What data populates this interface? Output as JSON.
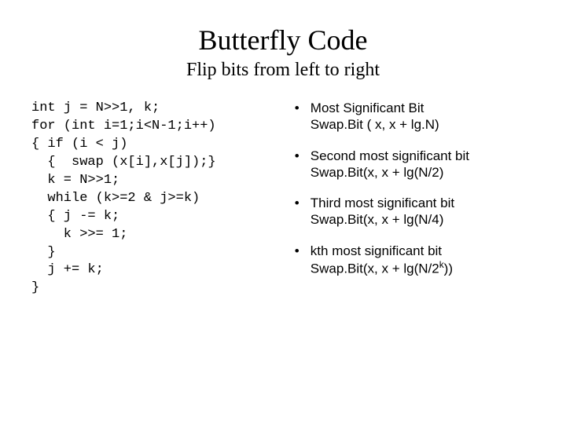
{
  "title": "Butterfly Code",
  "subtitle": "Flip bits from left to right",
  "code": "int j = N>>1, k;\nfor (int i=1;i<N-1;i++)\n{ if (i < j)\n  {  swap (x[i],x[j]);}\n  k = N>>1;\n  while (k>=2 & j>=k)\n  { j -= k;\n    k >>= 1;\n  }\n  j += k;\n}",
  "bullets": [
    {
      "line1": "Most Significant Bit",
      "line2_prefix": "Swap.Bit ( x, x + lg.N)"
    },
    {
      "line1": "Second most significant bit",
      "line2_prefix": "Swap.Bit(x, x + lg(N/2)"
    },
    {
      "line1": "Third most significant bit",
      "line2_prefix": "Swap.Bit(x, x + lg(N/4)"
    },
    {
      "line1": "kth most significant bit",
      "line2_prefix": "Swap.Bit(x, x + lg(N/2",
      "sup": "k",
      "line2_suffix": "))"
    }
  ]
}
